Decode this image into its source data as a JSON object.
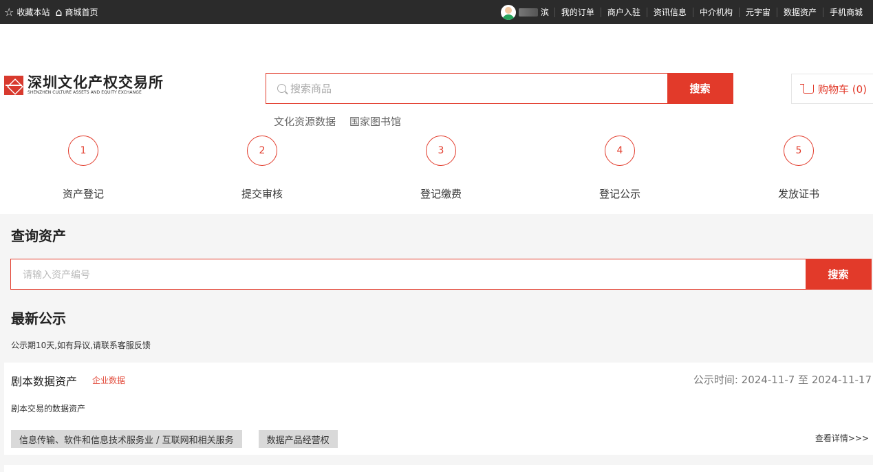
{
  "topbar": {
    "favorite": "收藏本站",
    "home": "商城首页",
    "user_name": "滨",
    "nav": [
      "我的订单",
      "商户入驻",
      "资讯信息",
      "中介机构",
      "元宇宙",
      "数据资产",
      "手机商城"
    ]
  },
  "header": {
    "logo_cn": "深圳文化产权交易所",
    "logo_en": "SHENZHEN CULTURE ASSETS AND EQUITY EXCHANGE",
    "search_placeholder": "搜索商品",
    "search_button": "搜索",
    "hot_links": [
      "文化资源数据",
      "国家图书馆"
    ],
    "cart_label": "购物车 (0)"
  },
  "steps": [
    {
      "num": "1",
      "label": "资产登记"
    },
    {
      "num": "2",
      "label": "提交审核"
    },
    {
      "num": "3",
      "label": "登记缴费"
    },
    {
      "num": "4",
      "label": "登记公示"
    },
    {
      "num": "5",
      "label": "发放证书"
    }
  ],
  "query": {
    "title": "查询资产",
    "placeholder": "请输入资产编号",
    "button": "搜索"
  },
  "latest": {
    "title": "最新公示",
    "notice": "公示期10天,如有异议,请联系客服反馈"
  },
  "cards": [
    {
      "title": "剧本数据资产",
      "tag": "企业数据",
      "time": "公示时间: 2024-11-7 至 2024-11-17",
      "desc": "剧本交易的数据资产",
      "chips": [
        "信息传输、软件和信息技术服务业 / 互联网和相关服务",
        "数据产品经营权"
      ],
      "more": "查看详情>>>"
    }
  ],
  "colors": {
    "accent": "#e23a2a",
    "topbar": "#2b2b2b"
  }
}
